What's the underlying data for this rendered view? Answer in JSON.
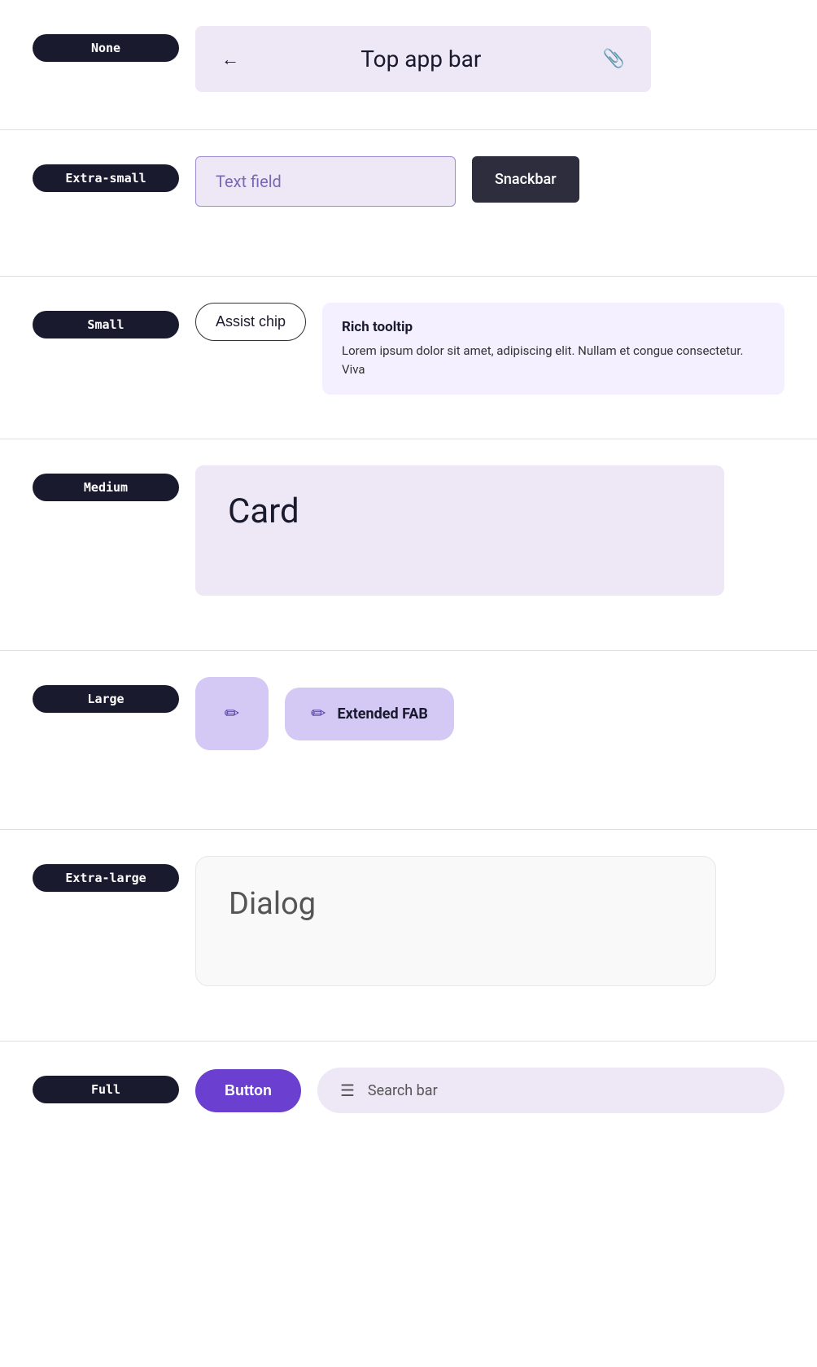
{
  "sections": [
    {
      "id": "none",
      "badge_label": "None",
      "content_type": "top_app_bar",
      "top_app_bar": {
        "title": "Top app bar",
        "back_icon": "←",
        "attach_icon": "📎"
      }
    },
    {
      "id": "extrasmall",
      "badge_label": "Extra-small",
      "content_type": "text_field_snackbar",
      "text_field": {
        "placeholder": "Text field"
      },
      "snackbar": {
        "label": "Snackbar"
      }
    },
    {
      "id": "small",
      "badge_label": "Small",
      "content_type": "assist_chip_tooltip",
      "assist_chip": {
        "label": "Assist chip"
      },
      "rich_tooltip": {
        "title": "Rich tooltip",
        "text": "Lorem ipsum dolor sit amet, adipiscing elit. Nullam et congue consectetur. Viva"
      }
    },
    {
      "id": "medium",
      "badge_label": "Medium",
      "content_type": "card",
      "card": {
        "title": "Card"
      }
    },
    {
      "id": "large",
      "badge_label": "Large",
      "content_type": "fab",
      "fab_icon": "✏",
      "fab_extended": {
        "icon": "✏",
        "label": "Extended FAB"
      }
    },
    {
      "id": "extralarge",
      "badge_label": "Extra-large",
      "content_type": "dialog",
      "dialog": {
        "title": "Dialog"
      }
    },
    {
      "id": "full",
      "badge_label": "Full",
      "content_type": "button_search",
      "button": {
        "label": "Button"
      },
      "search_bar": {
        "label": "Search bar",
        "hamburger": "☰"
      }
    }
  ]
}
